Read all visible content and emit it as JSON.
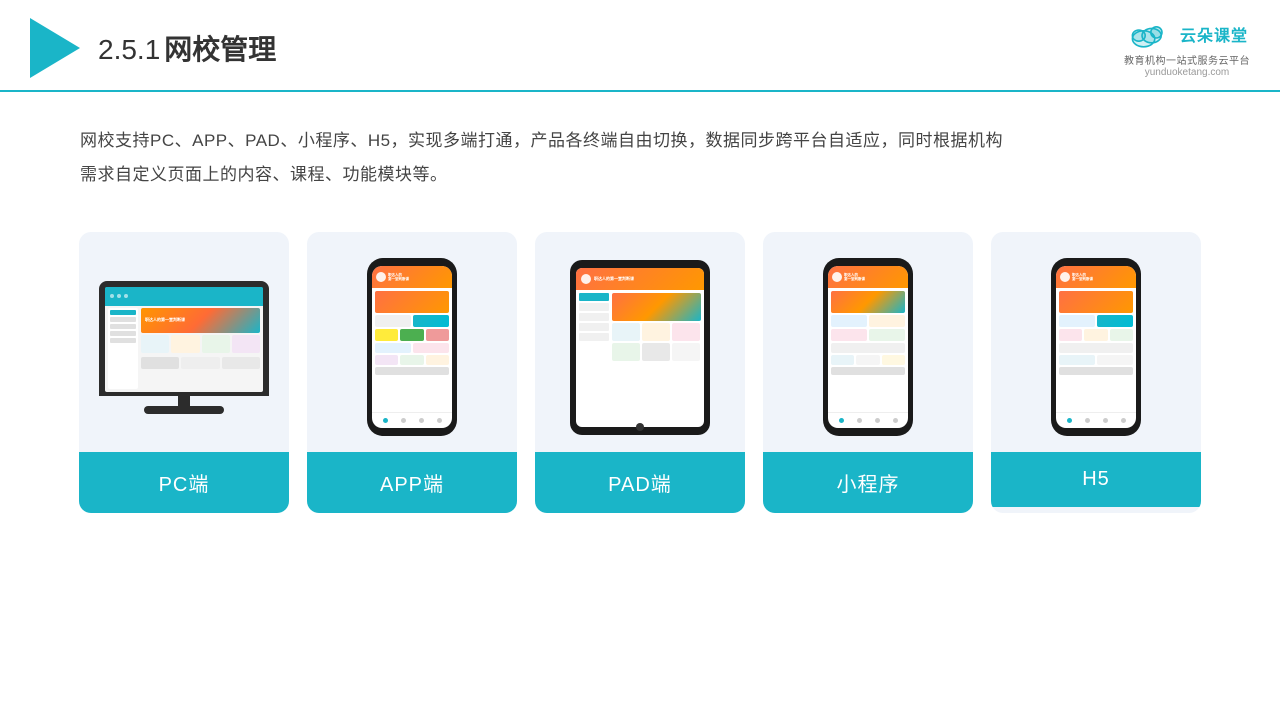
{
  "header": {
    "section_number": "2.5.1",
    "title": "网校管理",
    "brand_name": "云朵课堂",
    "brand_url": "yunduoketang.com",
    "brand_tagline": "教育机构一站式服务云平台"
  },
  "description": {
    "text1": "网校支持PC、APP、PAD、小程序、H5，实现多端打通，产品各终端自由切换，数据同步跨平台自适应，同时根据机构",
    "text2": "需求自定义页面上的内容、课程、功能模块等。"
  },
  "cards": [
    {
      "id": "pc",
      "label": "PC端"
    },
    {
      "id": "app",
      "label": "APP端"
    },
    {
      "id": "pad",
      "label": "PAD端"
    },
    {
      "id": "mini-program",
      "label": "小程序"
    },
    {
      "id": "h5",
      "label": "H5"
    }
  ]
}
